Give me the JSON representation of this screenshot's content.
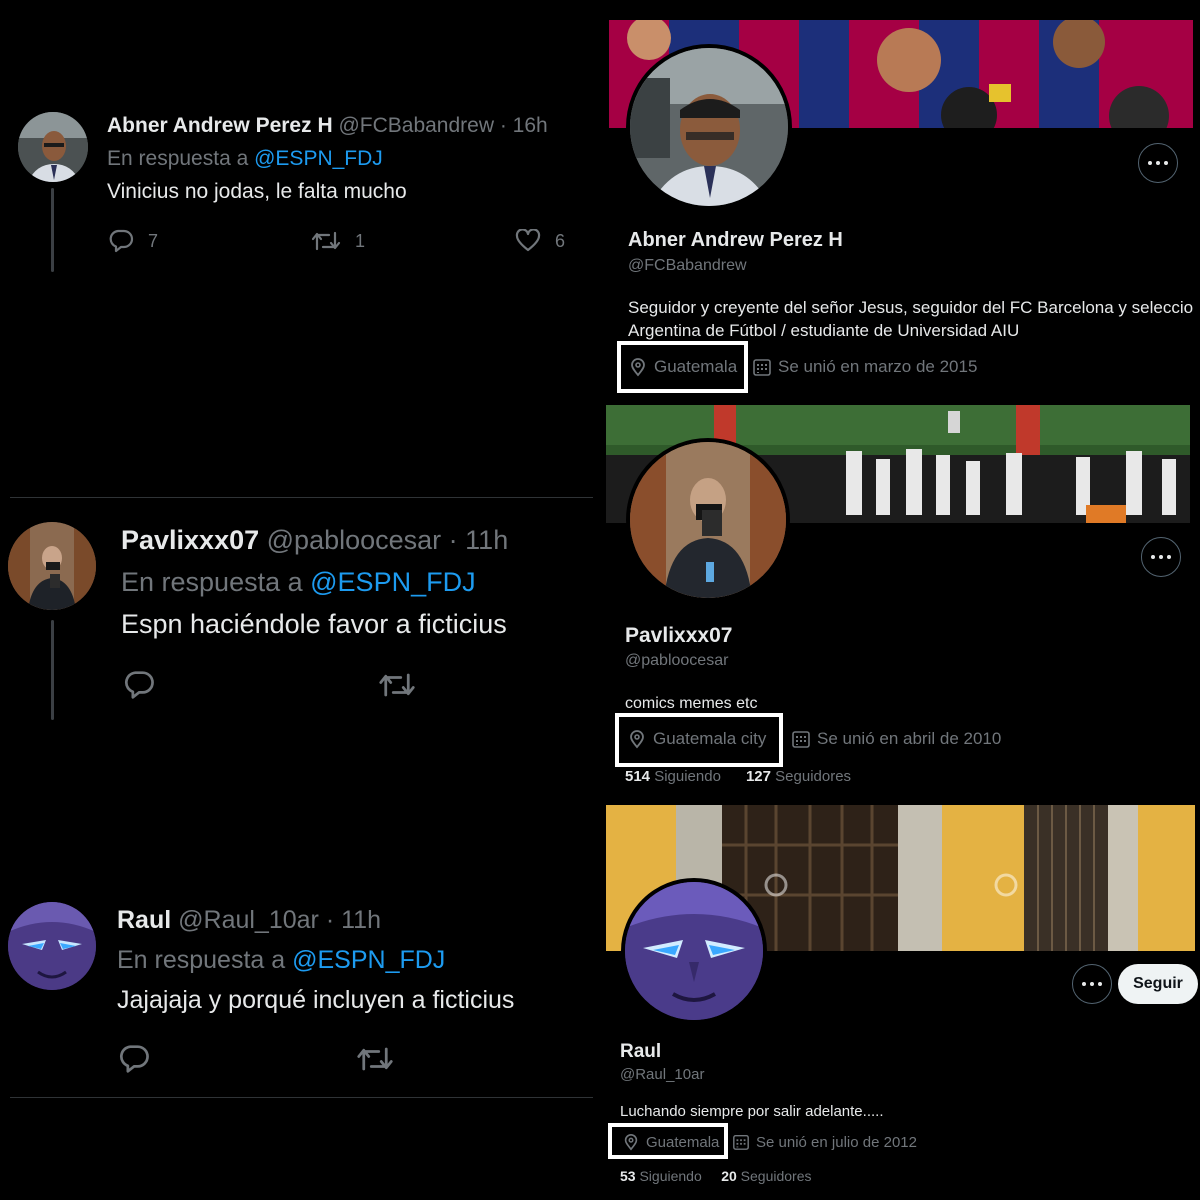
{
  "tweets": [
    {
      "name": "Abner Andrew Perez H",
      "handle": "@FCBabandrew",
      "time": "· 16h",
      "reply_prefix": "En respuesta a",
      "reply_to": "@ESPN_FDJ",
      "text": "Vinicius no jodas, le falta mucho",
      "replies": "7",
      "retweets": "1",
      "likes": "6"
    },
    {
      "name": "Pavlixxx07",
      "handle": "@pabloocesar",
      "time": "· 11h",
      "reply_prefix": "En respuesta a",
      "reply_to": "@ESPN_FDJ",
      "text": "Espn haciéndole favor a ficticius"
    },
    {
      "name": "Raul",
      "handle": "@Raul_10ar",
      "time": "· 11h",
      "reply_prefix": "En respuesta a",
      "reply_to": "@ESPN_FDJ",
      "text": "Jajajaja y porqué incluyen a ficticius"
    }
  ],
  "profiles": [
    {
      "name": "Abner Andrew Perez H",
      "handle": "@FCBabandrew",
      "bio_line1": "Seguidor y creyente del señor Jesus, seguidor del FC Barcelona y seleccio",
      "bio_line2": "Argentina de Fútbol / estudiante de Universidad AIU",
      "location": "Guatemala",
      "joined": "Se unió en marzo de 2015"
    },
    {
      "name": "Pavlixxx07",
      "handle": "@pabloocesar",
      "bio_line1": "comics memes etc",
      "location": "Guatemala city",
      "joined": "Se unió en abril de 2010",
      "following_count": "514",
      "following_label": "Siguiendo",
      "followers_count": "127",
      "followers_label": "Seguidores"
    },
    {
      "name": "Raul",
      "handle": "@Raul_10ar",
      "follow_button": "Seguir",
      "bio_line1": "Luchando siempre por salir adelante.....",
      "location": "Guatemala",
      "joined": "Se unió en julio de 2012",
      "following_count": "53",
      "following_label": "Siguiendo",
      "followers_count": "20",
      "followers_label": "Seguidores"
    }
  ],
  "colors": {
    "background": "#000000",
    "text": "#e7e9ea",
    "muted": "#71767b",
    "link": "#1d9bf0",
    "highlight_box": "#ffffff",
    "barca_blue": "#1c2f7a",
    "barca_red": "#a50044"
  },
  "icons": [
    "avatar-photo",
    "reply-icon",
    "retweet-icon",
    "like-icon",
    "more-icon",
    "location-icon",
    "calendar-icon"
  ]
}
